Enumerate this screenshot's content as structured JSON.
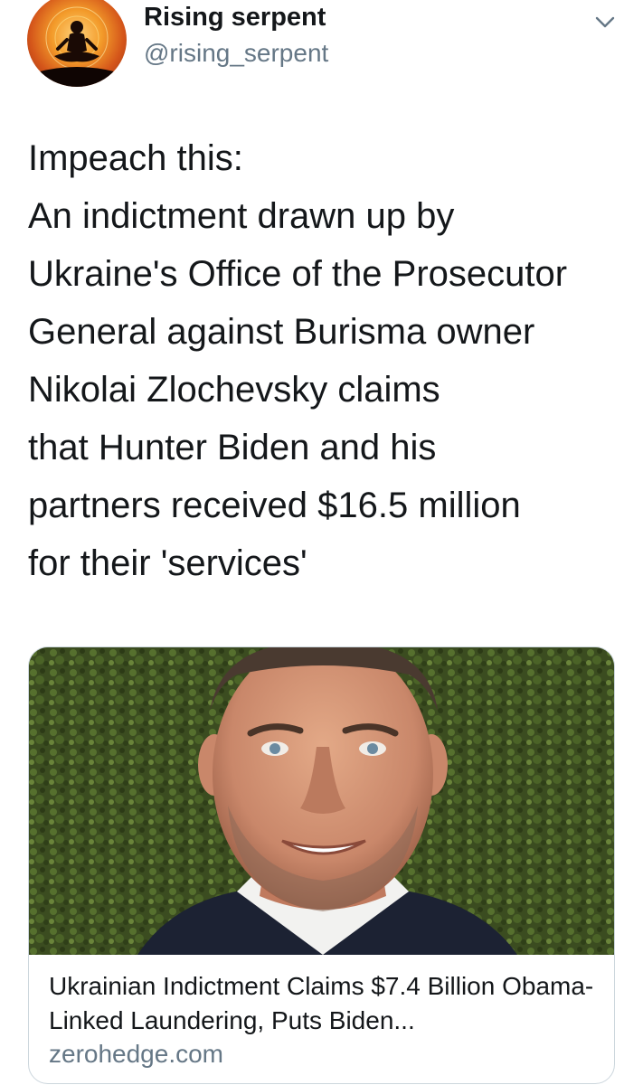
{
  "author": {
    "display_name": "Rising serpent",
    "handle": "@rising_serpent",
    "avatar_icon": "meditating-figure-avatar"
  },
  "tweet": {
    "text": "Impeach this:\nAn indictment drawn up by\nUkraine's Office of the Prosecutor\nGeneral against Burisma owner\nNikolai Zlochevsky claims\nthat Hunter Biden and his\npartners received $16.5 million\nfor their 'services'"
  },
  "menu": {
    "icon": "chevron-down-icon"
  },
  "link_card": {
    "title": "Ukrainian Indictment Claims $7.4 Billion Obama-Linked Laundering, Puts Biden...",
    "domain": "zerohedge.com",
    "image_icon": "man-portrait-photo"
  },
  "colors": {
    "text_primary": "#14171a",
    "text_secondary": "#657786",
    "card_border": "#ccd6dd"
  }
}
